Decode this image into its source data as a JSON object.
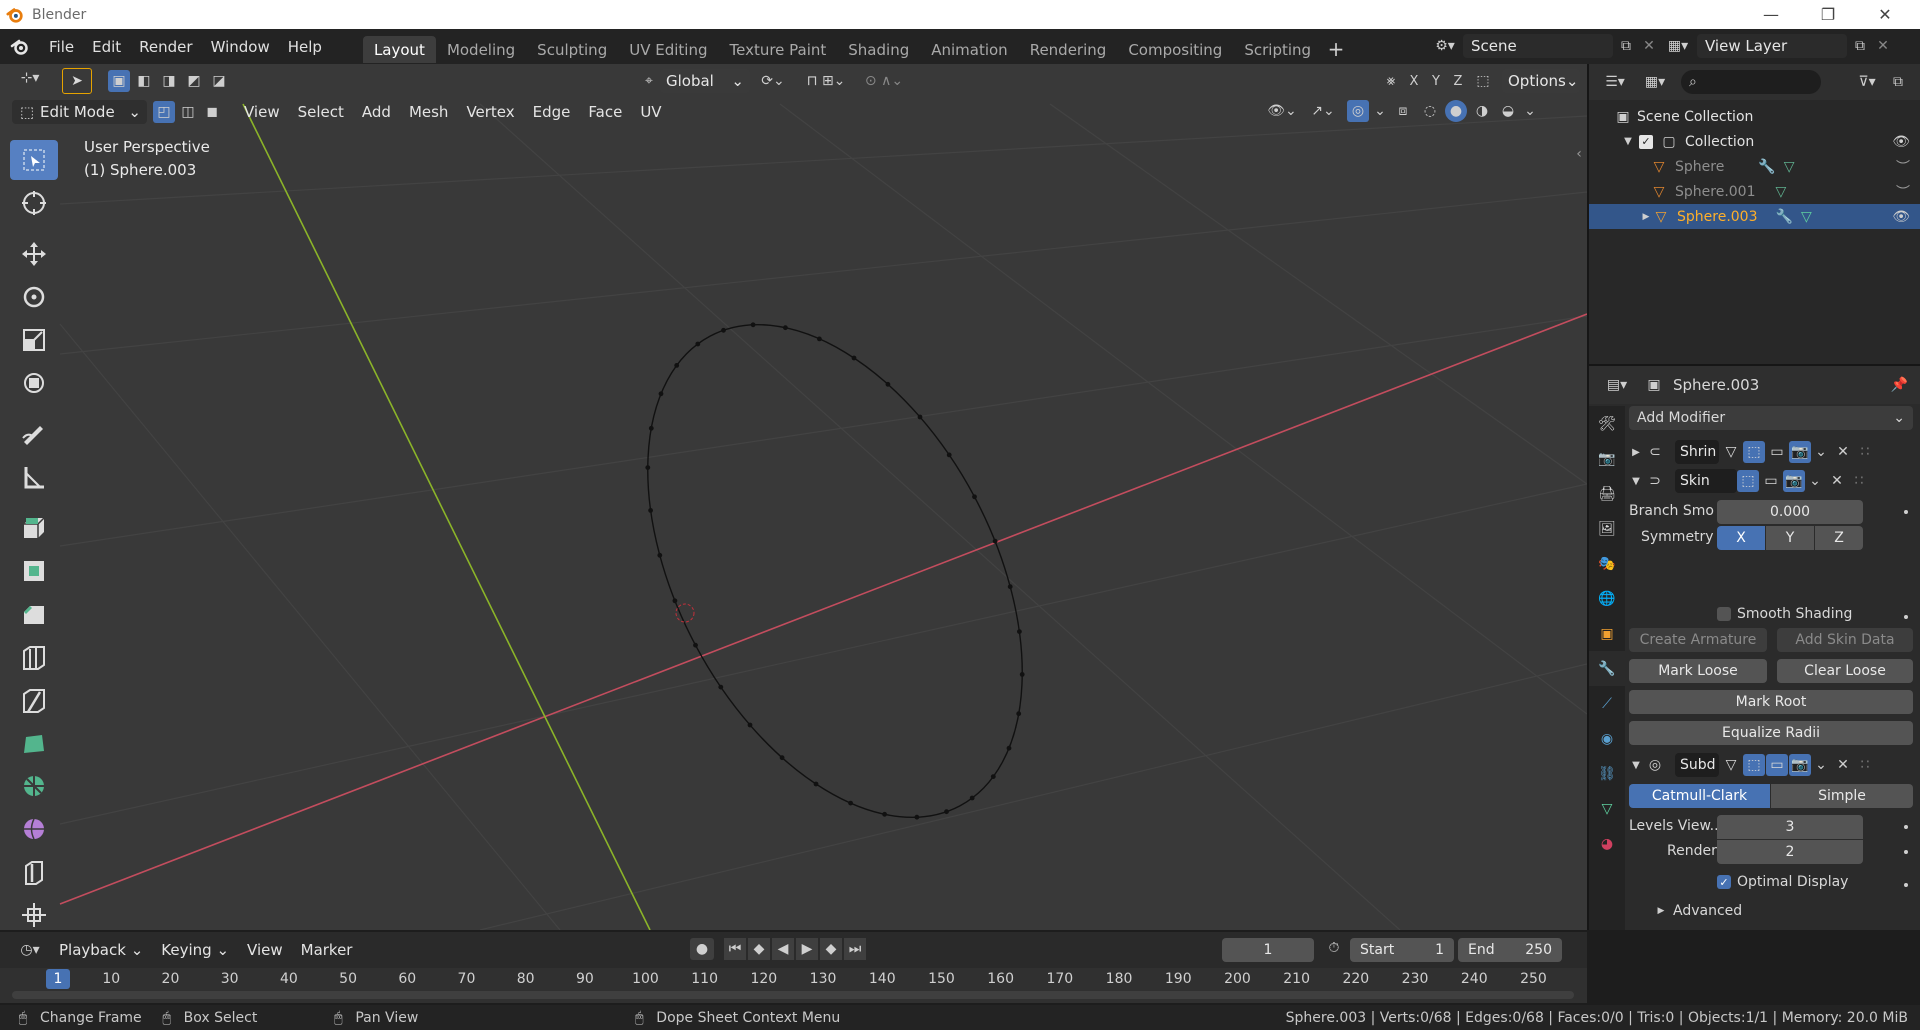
{
  "window": {
    "title": "Blender"
  },
  "menu": [
    "File",
    "Edit",
    "Render",
    "Window",
    "Help"
  ],
  "workspaces": [
    "Layout",
    "Modeling",
    "Sculpting",
    "UV Editing",
    "Texture Paint",
    "Shading",
    "Animation",
    "Rendering",
    "Compositing",
    "Scripting"
  ],
  "active_workspace": "Layout",
  "scene": "Scene",
  "view_layer": "View Layer",
  "viewport": {
    "mode": "Edit Mode",
    "menus": [
      "View",
      "Select",
      "Add",
      "Mesh",
      "Vertex",
      "Edge",
      "Face",
      "UV"
    ],
    "orientation": "Global",
    "axes": [
      "X",
      "Y",
      "Z"
    ],
    "options_label": "Options",
    "overlay_title": "User Perspective",
    "overlay_object": "(1) Sphere.003"
  },
  "outliner": {
    "root": "Scene Collection",
    "collection": "Collection",
    "objects": [
      {
        "name": "Sphere",
        "selected": false
      },
      {
        "name": "Sphere.001",
        "selected": false
      },
      {
        "name": "Sphere.003",
        "selected": true
      }
    ]
  },
  "properties": {
    "object_name": "Sphere.003",
    "add_modifier": "Add Modifier",
    "modifiers": {
      "shrink": "Shrin",
      "skin": {
        "name": "Skin",
        "branch_label": "Branch Smo",
        "branch_value": "0.000",
        "symmetry_label": "Symmetry",
        "symmetry_axes": [
          "X",
          "Y",
          "Z"
        ],
        "smooth_shading": "Smooth Shading",
        "create_armature": "Create Armature",
        "add_skin_data": "Add Skin Data",
        "mark_loose": "Mark Loose",
        "clear_loose": "Clear Loose",
        "mark_root": "Mark Root",
        "equalize_radii": "Equalize Radii"
      },
      "subdiv": {
        "name": "Subd",
        "catmull": "Catmull-Clark",
        "simple": "Simple",
        "levels_label": "Levels View...",
        "levels_value": "3",
        "render_label": "Render",
        "render_value": "2",
        "optimal_display": "Optimal Display",
        "optimal_checked": true,
        "advanced": "Advanced"
      }
    }
  },
  "timeline": {
    "menus": [
      "Playback",
      "Keying",
      "View",
      "Marker"
    ],
    "current_frame": "1",
    "start_label": "Start",
    "start_value": "1",
    "end_label": "End",
    "end_value": "250",
    "ruler_ticks": [
      "1",
      "10",
      "20",
      "30",
      "40",
      "50",
      "60",
      "70",
      "80",
      "90",
      "100",
      "110",
      "120",
      "130",
      "140",
      "150",
      "160",
      "170",
      "180",
      "190",
      "200",
      "210",
      "220",
      "230",
      "240",
      "250"
    ]
  },
  "status": {
    "change_frame": "Change Frame",
    "box_select": "Box Select",
    "pan_view": "Pan View",
    "context_menu": "Dope Sheet Context Menu",
    "stats": "Sphere.003 | Verts:0/68 | Edges:0/68 | Faces:0/0 | Tris:0 | Objects:1/1 | Memory: 20.0 MiB"
  },
  "colors": {
    "accent": "#4772b3",
    "x_axis": "#c34d5e",
    "y_axis": "#8bb429",
    "selected_text": "#ffaf29"
  }
}
